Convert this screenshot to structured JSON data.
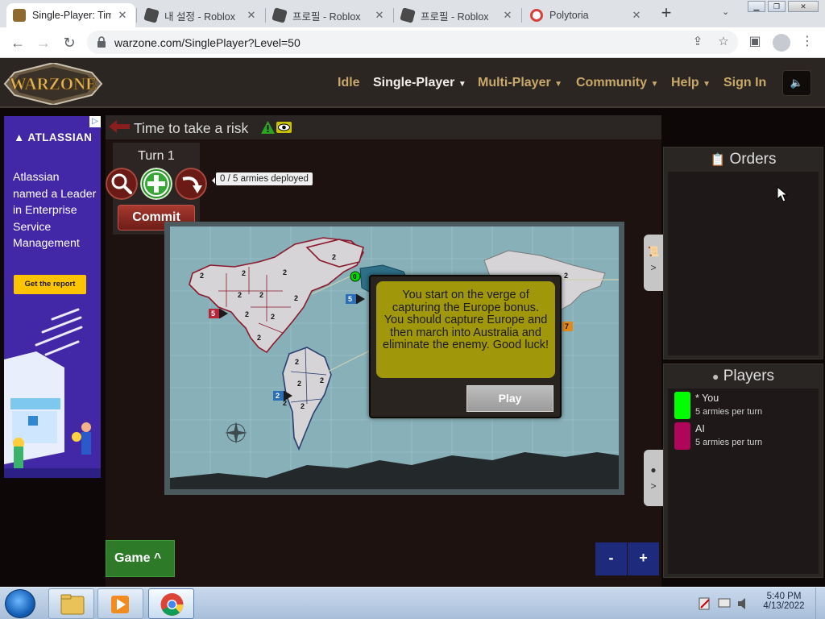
{
  "browser": {
    "tabs": [
      {
        "title": "Single-Player: Time to take a risk",
        "active": true
      },
      {
        "title": "내 설정 - Roblox",
        "active": false
      },
      {
        "title": "프로필 - Roblox",
        "active": false
      },
      {
        "title": "프로필 - Roblox",
        "active": false
      },
      {
        "title": "Polytoria",
        "active": false
      }
    ],
    "url": "warzone.com/SinglePlayer?Level=50"
  },
  "site": {
    "nav": [
      "Idle",
      "Single-Player",
      "Multi-Player",
      "Community",
      "Help",
      "Sign In"
    ],
    "logo_text": "WARZONE"
  },
  "ad": {
    "brand": "ATLASSIAN",
    "copy": "Atlassian named a Leader in Enterprise Service Management",
    "cta": "Get the report"
  },
  "game": {
    "title": "Time to take a risk",
    "turn": "Turn 1",
    "deployed": "0 / 5 armies deployed",
    "commit": "Commit",
    "game_button": "Game",
    "zoom_out": "-",
    "zoom_in": "+",
    "tutorial_text": "You start on the verge of capturing the Europe bonus.  You should capture Europe and then march into Australia and eliminate the enemy.  Good luck!",
    "play_button": "Play",
    "side_arrow": ">",
    "map": {
      "territory_armies": [
        "2",
        "2",
        "2",
        "2",
        "2",
        "2",
        "2",
        "2",
        "2",
        "2",
        "2",
        "2",
        "2",
        "2",
        "2",
        "2",
        "2",
        "2"
      ],
      "bonus_markers": [
        "5",
        "5",
        "2",
        "7"
      ],
      "territory_count": "0"
    }
  },
  "orders": {
    "title": "Orders"
  },
  "players": {
    "title": "Players",
    "list": [
      {
        "name": "* You",
        "income": "5 armies per turn",
        "color": "#00ff00"
      },
      {
        "name": "AI",
        "income": "5 armies per turn",
        "color": "#b0065a"
      }
    ]
  },
  "taskbar": {
    "time": "5:40 PM",
    "date": "4/13/2022"
  }
}
